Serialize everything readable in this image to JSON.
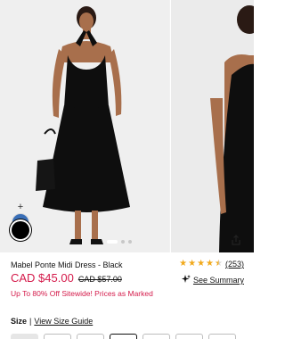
{
  "product": {
    "title": "Mabel Ponte Midi Dress - Black",
    "price_current": "CAD $45.00",
    "price_original": "CAD $57.00",
    "rating_count": "(253)",
    "rating_value": 4.5,
    "see_summary": "See Summary",
    "promo": "Up To 80% Off Sitewide! Prices as Marked"
  },
  "gallery": {
    "add_symbol": "+",
    "current_slide": 1,
    "slide_count": 3,
    "swatches": [
      "blue-denim",
      "black"
    ]
  },
  "size": {
    "label": "Size",
    "separator": "|",
    "guide_link": "View Size Guide"
  },
  "colors": {
    "price": "#d41a4a",
    "star": "#f1a91b"
  }
}
